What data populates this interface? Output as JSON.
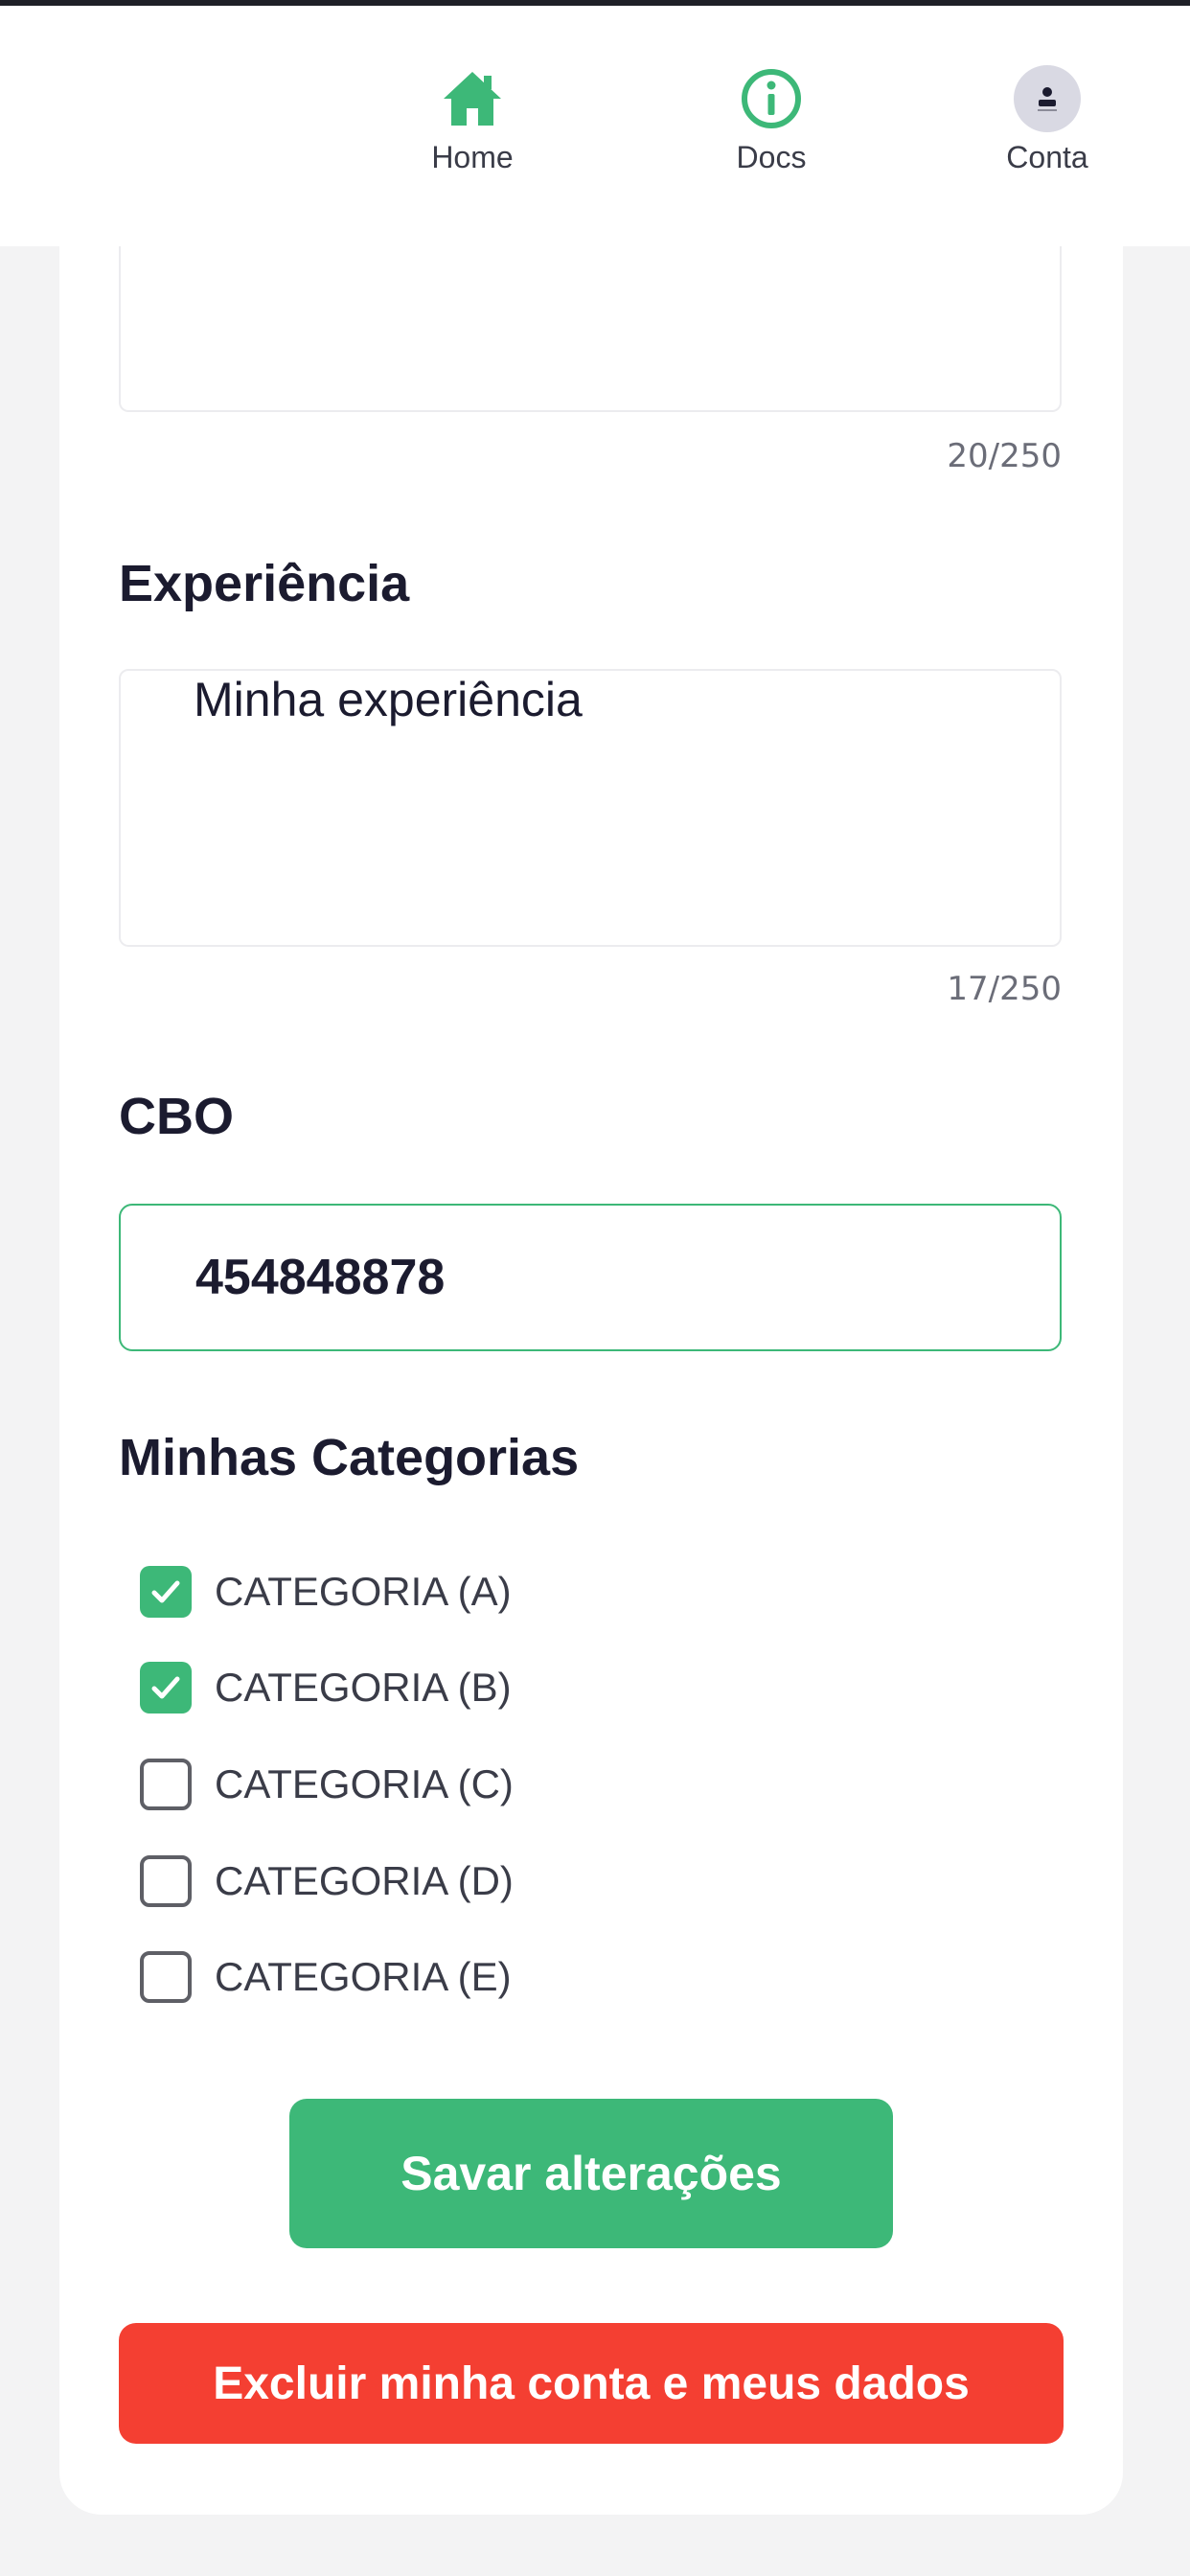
{
  "nav": {
    "items": [
      {
        "label": "Home",
        "icon": "home-icon"
      },
      {
        "label": "Docs",
        "icon": "info-icon"
      },
      {
        "label": "Conta",
        "icon": "avatar-icon"
      }
    ]
  },
  "form": {
    "first_textarea": {
      "counter": "20/250"
    },
    "experience": {
      "title": "Experiência",
      "value": "Minha experiência",
      "counter": "17/250"
    },
    "cbo": {
      "title": "CBO",
      "value": "454848878"
    },
    "categories": {
      "title": "Minhas Categorias",
      "items": [
        {
          "label": "CATEGORIA (A)",
          "checked": true
        },
        {
          "label": "CATEGORIA (B)",
          "checked": true
        },
        {
          "label": "CATEGORIA (C)",
          "checked": false
        },
        {
          "label": "CATEGORIA (D)",
          "checked": false
        },
        {
          "label": "CATEGORIA (E)",
          "checked": false
        }
      ]
    }
  },
  "actions": {
    "save_label": "Savar alterações",
    "delete_label": "Excluir minha conta e meus dados"
  },
  "colors": {
    "accent": "#3db878",
    "danger": "#f43f32",
    "background": "#f3f3f4"
  }
}
